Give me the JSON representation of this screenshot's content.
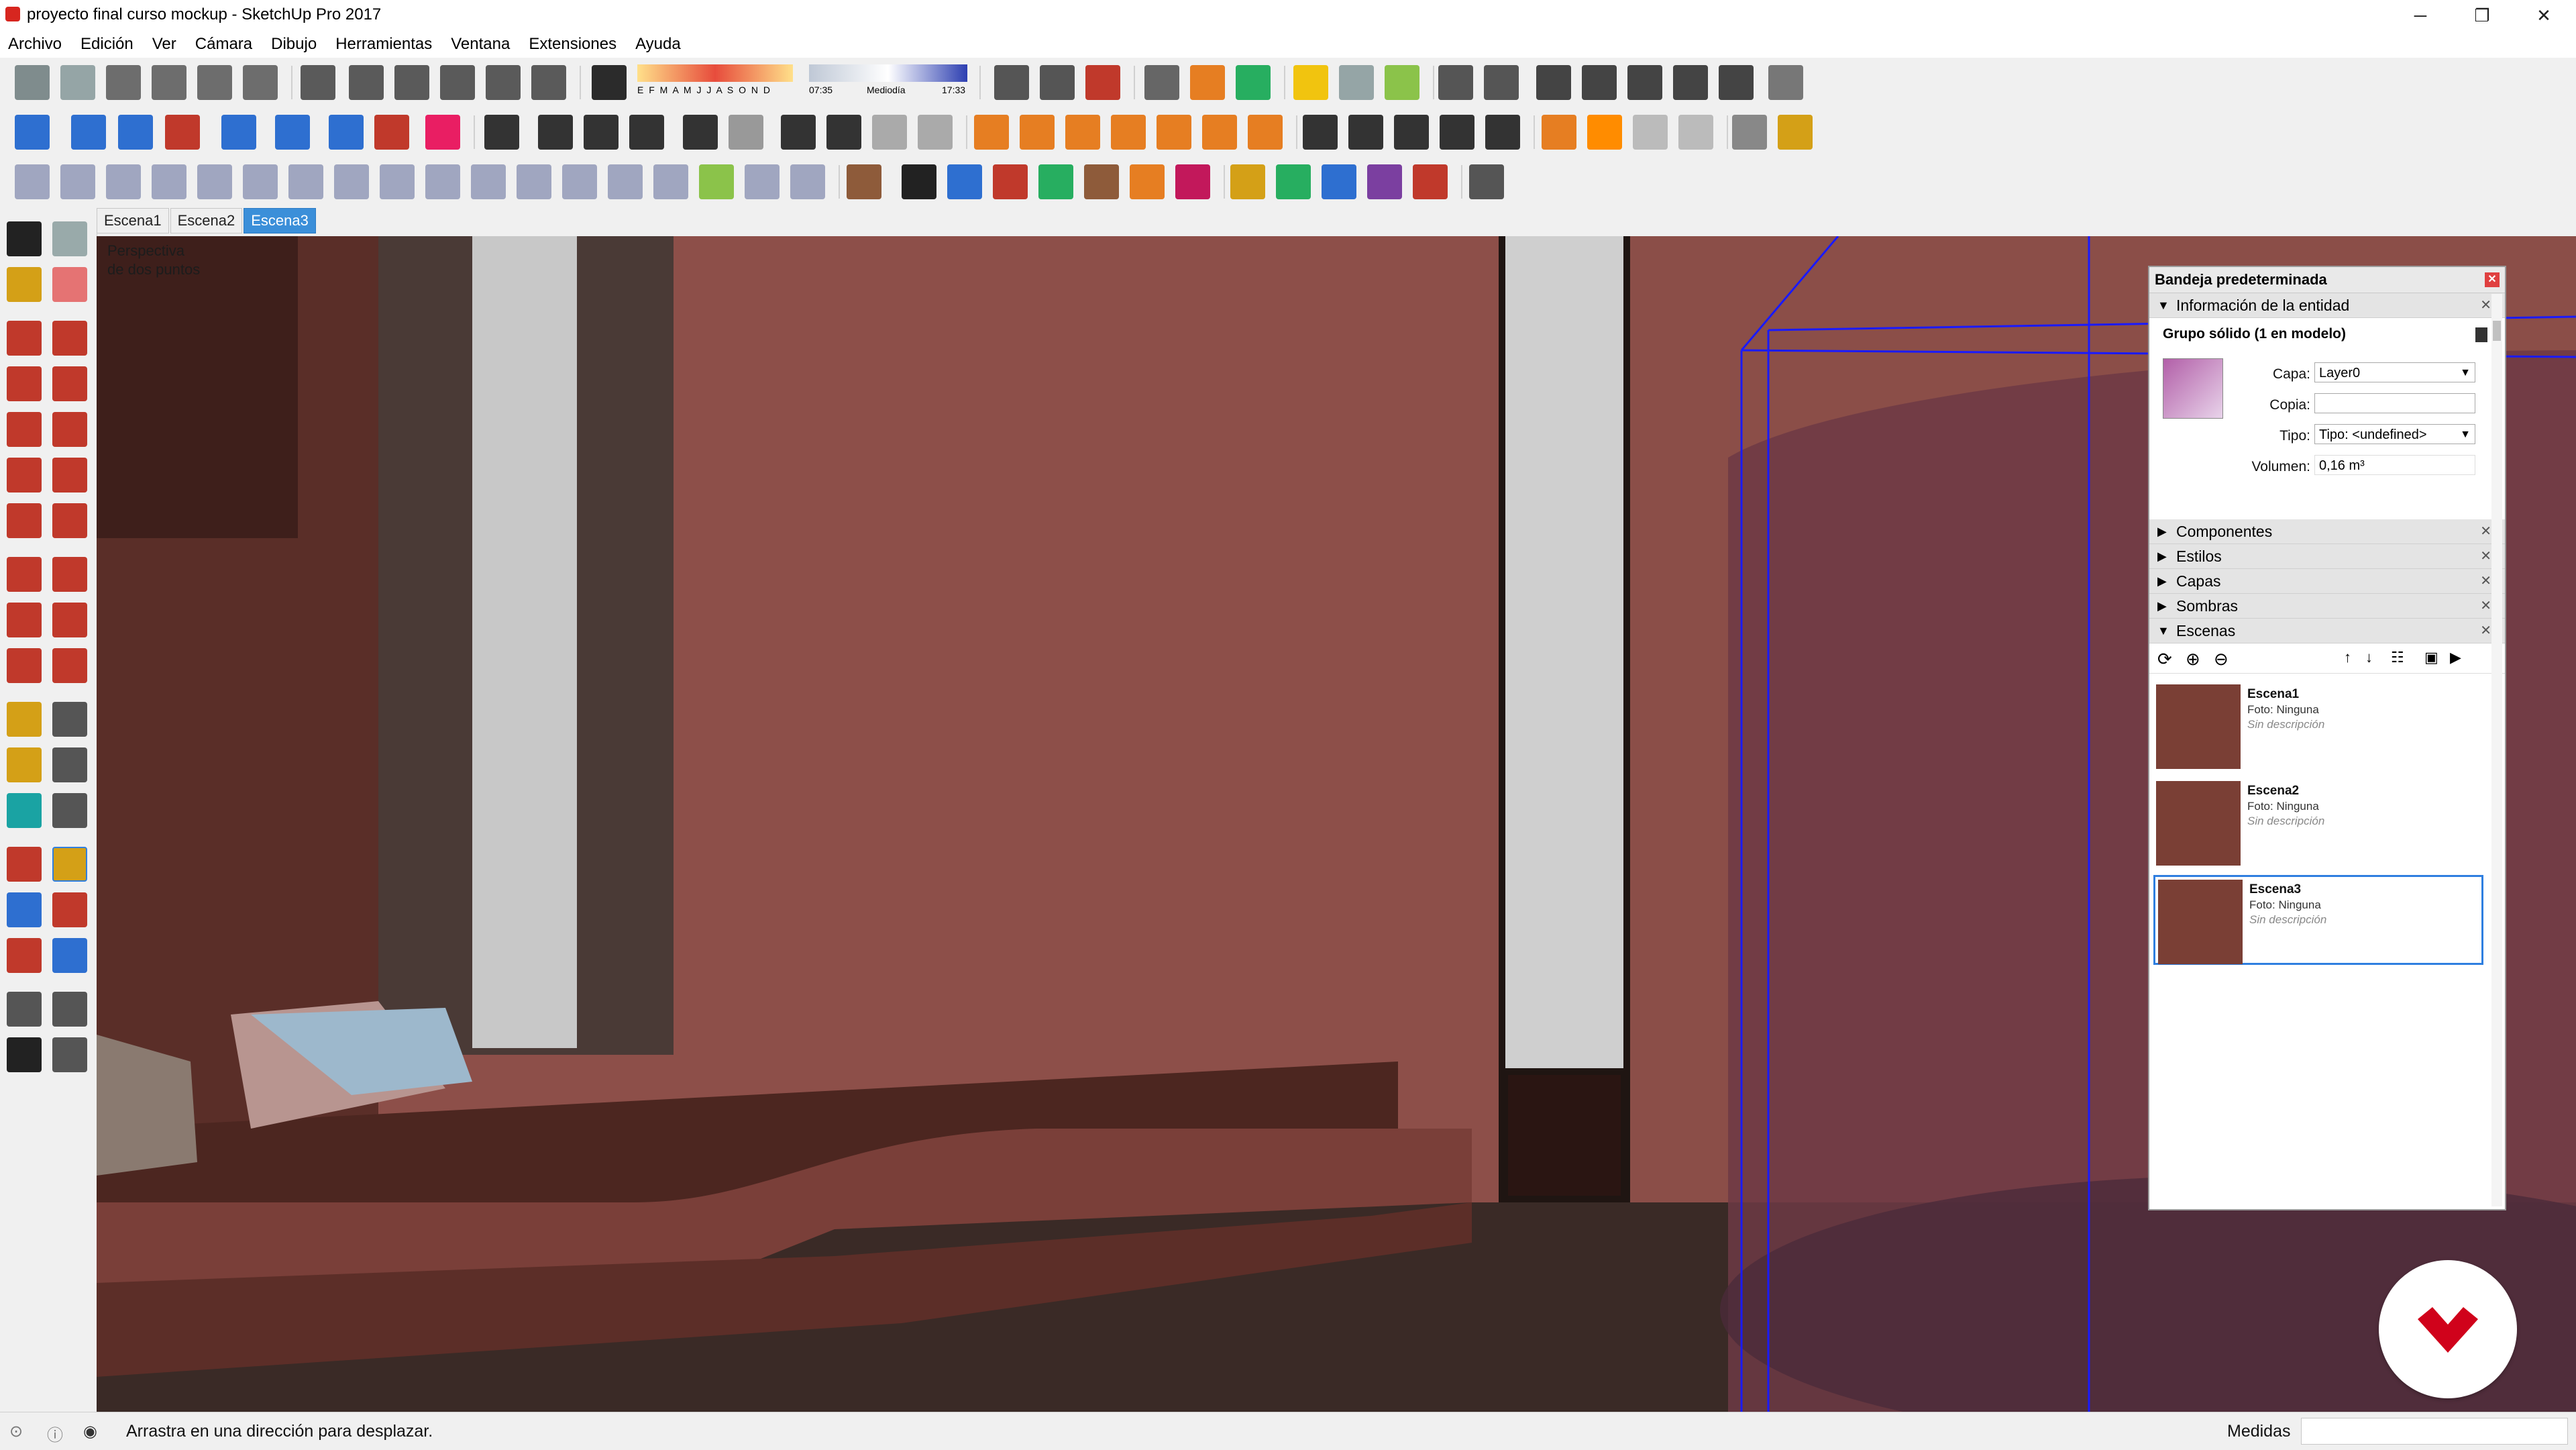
{
  "window": {
    "title": "proyecto final curso mockup - SketchUp Pro 2017",
    "minimize_glyph": "─",
    "restore_glyph": "❐",
    "close_glyph": "✕"
  },
  "menu": [
    "Archivo",
    "Edición",
    "Ver",
    "Cámara",
    "Dibujo",
    "Herramientas",
    "Ventana",
    "Extensiones",
    "Ayuda"
  ],
  "toolbar": {
    "shadow_months": "E F M A M J J A S O N D",
    "time_start": "07:35",
    "time_mid": "Mediodía",
    "time_end": "17:33"
  },
  "scene_tabs": [
    "Escena1",
    "Escena2",
    "Escena3"
  ],
  "active_scene_tab": "Escena3",
  "viewport": {
    "overlay_line1": "Perspectiva",
    "overlay_line2": "de dos puntos"
  },
  "tray": {
    "title": "Bandeja predeterminada",
    "entity_panel": {
      "header": "Información de la entidad",
      "entity_title": "Grupo sólido (1 en modelo)",
      "capa_label": "Capa:",
      "capa_value": "Layer0",
      "copia_label": "Copia:",
      "copia_value": "",
      "tipo_label": "Tipo:",
      "tipo_value": "Tipo: <undefined>",
      "volumen_label": "Volumen:",
      "volumen_value": "0,16 m³"
    },
    "panels": [
      "Componentes",
      "Estilos",
      "Capas",
      "Sombras",
      "Escenas"
    ],
    "scenes": [
      {
        "name": "Escena1",
        "foto": "Foto: Ninguna",
        "desc": "Sin descripción"
      },
      {
        "name": "Escena2",
        "foto": "Foto: Ninguna",
        "desc": "Sin descripción"
      },
      {
        "name": "Escena3",
        "foto": "Foto: Ninguna",
        "desc": "Sin descripción"
      }
    ]
  },
  "status": {
    "message": "Arrastra en una dirección para desplazar.",
    "measure_label": "Medidas",
    "measure_value": ""
  },
  "colors": {
    "accent": "#3b8fd9",
    "wall": "#8b4e48",
    "floor": "#3a2a26",
    "selection_blue": "#1a1aff",
    "logo_red": "#d0021b"
  }
}
